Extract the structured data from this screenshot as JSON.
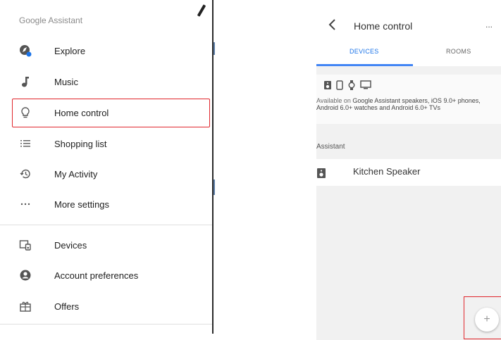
{
  "drawer": {
    "title": "Google Assistant",
    "items": [
      {
        "label": "Explore",
        "icon": "explore-icon"
      },
      {
        "label": "Music",
        "icon": "music-note-icon"
      },
      {
        "label": "Home control",
        "icon": "lightbulb-icon"
      },
      {
        "label": "Shopping list",
        "icon": "list-icon"
      },
      {
        "label": "My Activity",
        "icon": "history-icon"
      },
      {
        "label": "More settings",
        "icon": "more-dots-icon"
      },
      {
        "label": "Devices",
        "icon": "devices-icon"
      },
      {
        "label": "Account preferences",
        "icon": "account-circle-icon"
      },
      {
        "label": "Offers",
        "icon": "gift-icon"
      }
    ],
    "selected": "Home control"
  },
  "screen": {
    "title": "Home control",
    "more_label": "...",
    "tabs": [
      {
        "label": "DEVICES",
        "active": true
      },
      {
        "label": "ROOMS",
        "active": false
      }
    ],
    "availability_prefix": "Available on ",
    "availability_text": "Google Assistant speakers, iOS 9.0+ phones, Android 6.0+ watches and Android 6.0+ TVs",
    "section_label": "Assistant",
    "devices": [
      {
        "name": "Kitchen Speaker",
        "icon": "speaker-icon"
      }
    ],
    "fab_label": "+"
  },
  "colors": {
    "accent": "#4285f4",
    "highlight": "#e0252b",
    "explore_badge": "#1a73e8"
  }
}
